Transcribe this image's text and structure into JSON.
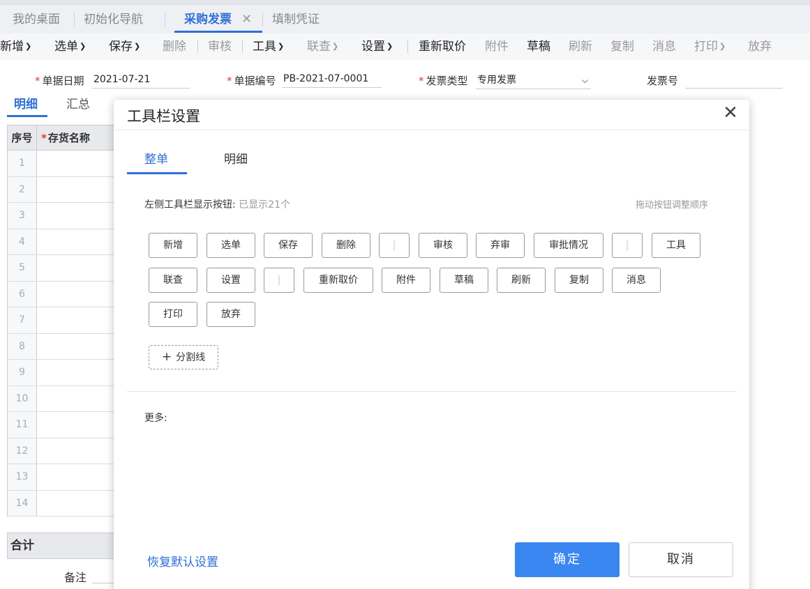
{
  "tabs": [
    {
      "label": "我的桌面",
      "active": false
    },
    {
      "label": "初始化导航",
      "active": false
    },
    {
      "label": "采购发票",
      "active": true
    },
    {
      "label": "填制凭证",
      "active": false
    }
  ],
  "toolbar": {
    "add": "新增",
    "select": "选单",
    "save": "保存",
    "delete": "删除",
    "audit": "审核",
    "tools": "工具",
    "linked_query": "联查",
    "settings": "设置",
    "reprice": "重新取价",
    "attachment": "附件",
    "draft": "草稿",
    "refresh": "刷新",
    "copy": "复制",
    "message": "消息",
    "print": "打印",
    "abandon": "放弃"
  },
  "form": {
    "date_label": "单据日期",
    "date_value": "2021-07-21",
    "number_label": "单据编号",
    "number_value": "PB-2021-07-0001",
    "invoice_type_label": "发票类型",
    "invoice_type_value": "专用发票",
    "invoice_no_label": "发票号"
  },
  "subtabs": {
    "detail": "明细",
    "summary": "汇总"
  },
  "grid": {
    "col_seq": "序号",
    "col_name": "存货名称",
    "rows": [
      "1",
      "2",
      "3",
      "4",
      "5",
      "6",
      "7",
      "8",
      "9",
      "10",
      "11",
      "12",
      "13",
      "14"
    ],
    "total": "合计",
    "remark": "备注"
  },
  "modal": {
    "title": "工具栏设置",
    "tabs": {
      "whole": "整单",
      "detail": "明细"
    },
    "left_label": "左侧工具栏显示按钮:",
    "left_count": "已显示21个",
    "drag_hint": "拖动按钮调整顺序",
    "buttons": {
      "add": "新增",
      "select": "选单",
      "save": "保存",
      "delete": "删除",
      "sep": "|",
      "audit": "审核",
      "unaudit": "弃审",
      "approval": "审批情况",
      "tools": "工具",
      "linked_query": "联查",
      "settings": "设置",
      "reprice": "重新取价",
      "attachment": "附件",
      "draft": "草稿",
      "refresh": "刷新",
      "copy": "复制",
      "message": "消息",
      "print": "打印",
      "abandon": "放弃"
    },
    "add_separator": "分割线",
    "more_label": "更多:",
    "restore_default": "恢复默认设置",
    "confirm": "确定",
    "cancel": "取消"
  }
}
